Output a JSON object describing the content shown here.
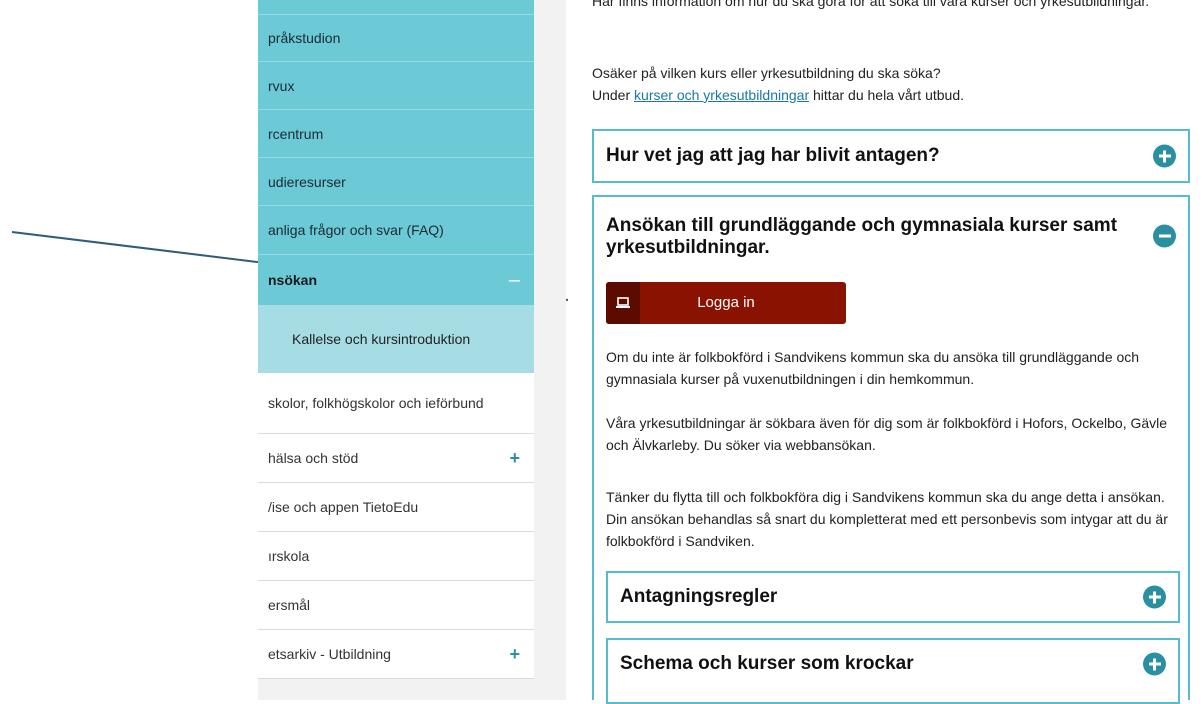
{
  "sidebar": {
    "items": [
      {
        "label": "pråkstudion",
        "style": "teal"
      },
      {
        "label": "rvux",
        "style": "teal"
      },
      {
        "label": "rcentrum",
        "style": "teal"
      },
      {
        "label": "udieresurser",
        "style": "teal"
      },
      {
        "label": "anliga frågor och svar (FAQ)",
        "style": "teal"
      },
      {
        "label": "nsökan",
        "style": "active",
        "toggle": "–"
      },
      {
        "label": "Kallelse och kursintroduktion",
        "style": "sub"
      },
      {
        "label": "skolor, folkhögskolor och ieförbund",
        "style": "plain"
      },
      {
        "label": "hälsa och stöd",
        "style": "plain",
        "toggle": "+"
      },
      {
        "label": "/ise och appen TietoEdu",
        "style": "plain"
      },
      {
        "label": "ırskola",
        "style": "plain"
      },
      {
        "label": "ersmål",
        "style": "plain"
      },
      {
        "label": "etsarkiv - Utbildning",
        "style": "plain",
        "toggle": "+"
      }
    ]
  },
  "main": {
    "intro_line": "Här finns information om hur du ska göra för att söka till våra kurser och yrkesutbildningar.",
    "unsure_line": "Osäker på vilken kurs eller yrkesutbildning du ska söka?",
    "under_prefix": "Under ",
    "under_link": "kurser och yrkesutbildningar",
    "under_suffix": " hittar du hela vårt utbud.",
    "accordion1_title": "Hur vet jag att jag har blivit antagen?",
    "accordion2_title": "Ansökan till grundläggande och gymnasiala kurser samt yrkesutbildningar.",
    "login_label": "Logga in",
    "para1": "Om du inte är folkbokförd i Sandvikens kommun ska du ansöka till grundläggande och gymnasiala kurser på vuxenutbildningen i din hemkommun.",
    "para2": "Våra yrkesutbildningar är sökbara även för dig som är folkbokförd i Hofors, Ockelbo, Gävle och Älvkarleby. Du söker via webbansökan.",
    "para3": "Tänker du flytta till och folkbokföra dig i Sandvikens kommun ska du ange detta i ansökan. Din ansökan behandlas så snart du kompletterat med ett personbevis som intygar att du är folkbokförd i Sandviken.",
    "sub_accordion1_title": "Antagningsregler",
    "sub_accordion2_title": "Schema och kurser som krockar"
  },
  "colors": {
    "teal_nav": "#6cc9d6",
    "teal_sub": "#a6dde5",
    "accent": "#2a8fa0",
    "border": "#54bccb",
    "login_bg": "#8a1200",
    "arrow": "#2e5c7c"
  }
}
